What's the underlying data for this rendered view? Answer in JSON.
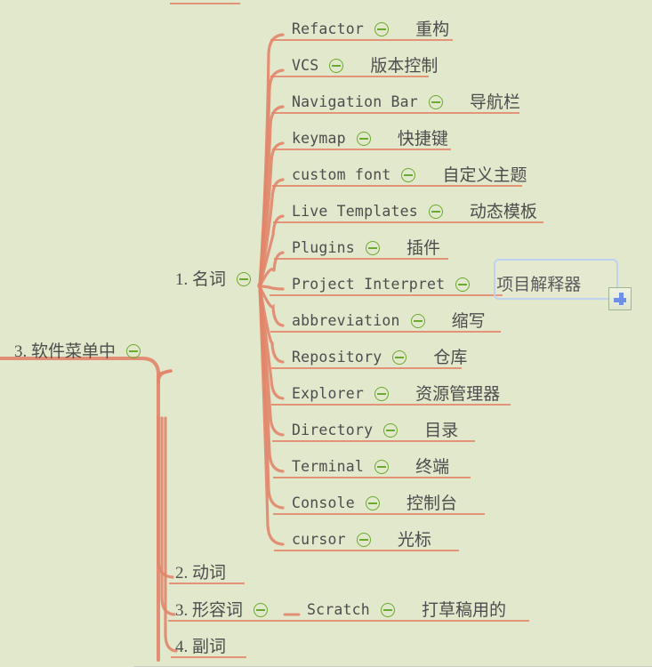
{
  "app": {
    "kind": "mind-map",
    "background_color": "#e2e8cc",
    "branch_color": "#e2866c",
    "text_color": "#4f4f4f",
    "collapse_icon_color": "#6aaa2e",
    "selection_border_color": "#bdd2f0",
    "plus_icon_color": "#6d8fe8"
  },
  "root": {
    "label": "3. 软件菜单中",
    "collapse_icon": "minus-circle-icon"
  },
  "branches": [
    {
      "label": "1. 名词",
      "collapse_icon": "minus-circle-icon"
    },
    {
      "label": "2. 动词",
      "collapse_icon": null
    },
    {
      "label": "3. 形容词",
      "collapse_icon": "minus-circle-icon"
    },
    {
      "label": "4. 副词",
      "collapse_icon": null
    }
  ],
  "noun_children": [
    {
      "term": "Refactor",
      "cn": "重构",
      "collapse_icon": "minus-circle-icon"
    },
    {
      "term": "VCS",
      "cn": "版本控制",
      "collapse_icon": "minus-circle-icon"
    },
    {
      "term": "Navigation Bar",
      "cn": "导航栏",
      "collapse_icon": "minus-circle-icon"
    },
    {
      "term": "keymap",
      "cn": "快捷键",
      "collapse_icon": "minus-circle-icon"
    },
    {
      "term": "custom font",
      "cn": "自定义主题",
      "collapse_icon": "minus-circle-icon"
    },
    {
      "term": "Live Templates",
      "cn": "动态模板",
      "collapse_icon": "minus-circle-icon"
    },
    {
      "term": "Plugins",
      "cn": "插件",
      "collapse_icon": "minus-circle-icon"
    },
    {
      "term": "Project Interpret",
      "cn": "项目解释器",
      "collapse_icon": "minus-circle-icon",
      "selected": true
    },
    {
      "term": "abbreviation",
      "cn": "缩写",
      "collapse_icon": "minus-circle-icon"
    },
    {
      "term": "Repository",
      "cn": "仓库",
      "collapse_icon": "minus-circle-icon"
    },
    {
      "term": "Explorer",
      "cn": "资源管理器",
      "collapse_icon": "minus-circle-icon"
    },
    {
      "term": "Directory",
      "cn": "目录",
      "collapse_icon": "minus-circle-icon"
    },
    {
      "term": "Terminal",
      "cn": "终端",
      "collapse_icon": "minus-circle-icon"
    },
    {
      "term": "Console",
      "cn": "控制台",
      "collapse_icon": "minus-circle-icon"
    },
    {
      "term": "cursor",
      "cn": "光标",
      "collapse_icon": "minus-circle-icon"
    }
  ],
  "adjective_child": {
    "term": "Scratch",
    "cn": "打草稿用的",
    "collapse_icon": "minus-circle-icon"
  },
  "selection": {
    "node_label": "项目解释器",
    "add_button_icon": "plus-icon"
  }
}
